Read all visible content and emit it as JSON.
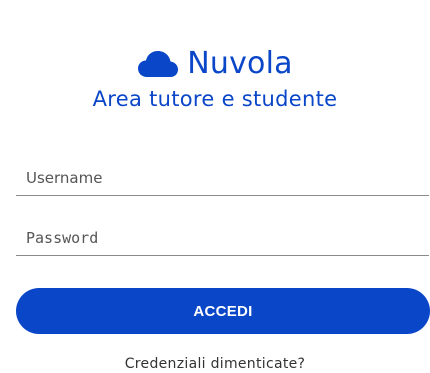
{
  "brand": {
    "name": "Nuvola",
    "logo_icon": "cloud-icon",
    "color": "#0a46c8"
  },
  "subtitle": "Area tutore e studente",
  "form": {
    "username": {
      "placeholder": "Username",
      "value": ""
    },
    "password": {
      "placeholder": "Password",
      "value": ""
    },
    "submit_label": "ACCEDI"
  },
  "forgot_link": "Credenziali dimenticate?"
}
